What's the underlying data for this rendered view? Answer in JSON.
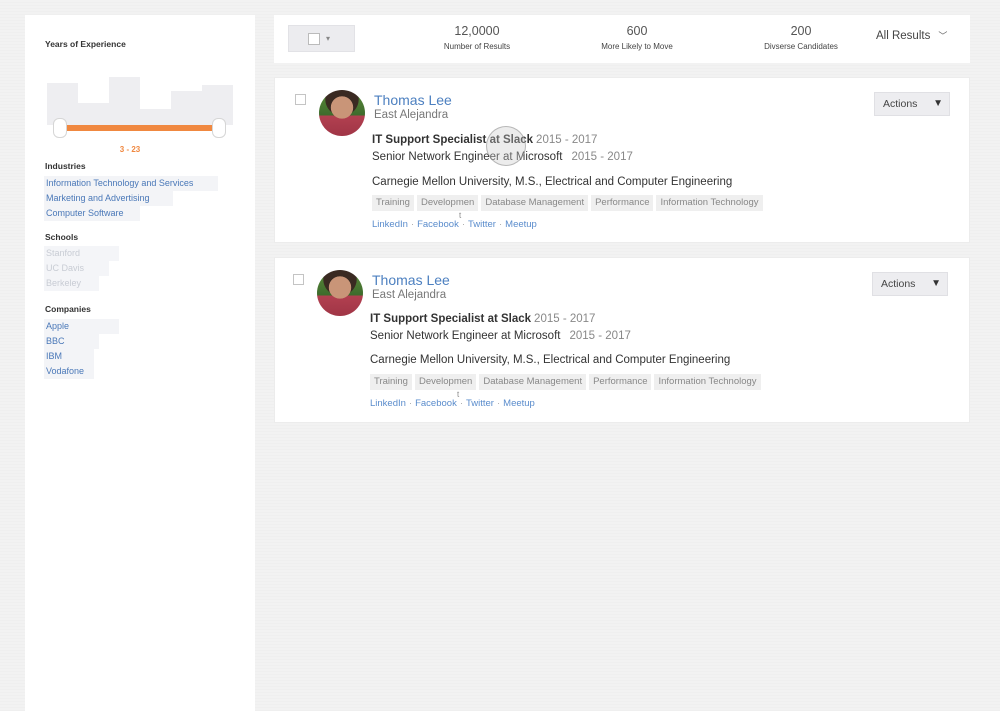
{
  "sidebar": {
    "experience": {
      "title": "Years of Experience",
      "range": "3 - 23",
      "accent": "#f08840"
    },
    "industries": {
      "title": "Industries",
      "items": [
        "Information Technology and Services",
        "Marketing and Advertising",
        "Computer Software"
      ]
    },
    "schools": {
      "title": "Schools",
      "items": [
        "Stanford",
        "UC Davis",
        "Berkeley"
      ]
    },
    "companies": {
      "title": "Companies",
      "items": [
        "Apple",
        "BBC",
        "IBM",
        "Vodafone"
      ]
    }
  },
  "topbar": {
    "stats": [
      {
        "value": "12,0000",
        "label": "Number of Results"
      },
      {
        "value": "600",
        "label": "More Likely to Move"
      },
      {
        "value": "200",
        "label": "Divserse Candidates"
      }
    ],
    "filter": "All Results",
    "filter_icon": "chevron-down-icon",
    "select_caret": "▾"
  },
  "cards": [
    {
      "name": "Thomas Lee",
      "location": "East Alejandra",
      "jobs": [
        {
          "title": "IT Support Specialist at Slack",
          "years": "2015 - 2017"
        },
        {
          "title": "Senior Network Engineer at Microsoft",
          "years": "2015 - 2017"
        }
      ],
      "education": "Carnegie Mellon University, M.S., Electrical and Computer Engineering",
      "tags": [
        "Training",
        "Developmen",
        "Database Management",
        "Performance",
        "Information Technology"
      ],
      "tag_overflow": "t",
      "links": [
        "LinkedIn",
        "Facebook",
        "Twitter",
        "Meetup"
      ],
      "actions": "Actions",
      "actions_caret": "▼"
    },
    {
      "name": "Thomas Lee",
      "location": "East Alejandra",
      "jobs": [
        {
          "title": "IT Support Specialist at Slack",
          "years": "2015 - 2017"
        },
        {
          "title": "Senior Network Engineer at Microsoft",
          "years": "2015 - 2017"
        }
      ],
      "education": "Carnegie Mellon University, M.S., Electrical and Computer Engineering",
      "tags": [
        "Training",
        "Developmen",
        "Database Management",
        "Performance",
        "Information Technology"
      ],
      "tag_overflow": "t",
      "links": [
        "LinkedIn",
        "Facebook",
        "Twitter",
        "Meetup"
      ],
      "actions": "Actions",
      "actions_caret": "▼"
    }
  ],
  "link_separator": "·"
}
